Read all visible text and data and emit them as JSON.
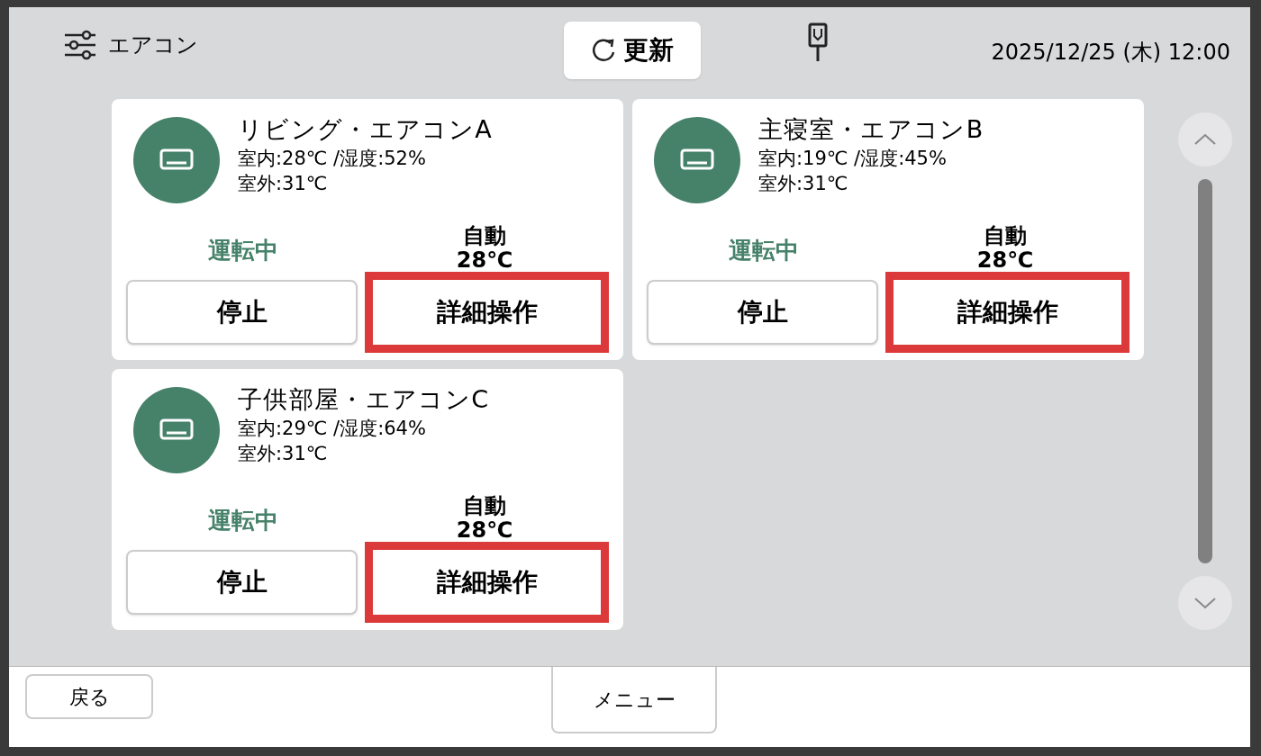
{
  "header": {
    "title": "エアコン",
    "refresh_button": "更新",
    "datetime": "2025/12/25 (木) 12:00"
  },
  "units": [
    {
      "name": "リビング・エアコンA",
      "indoor": "室内:28℃ /湿度:52%",
      "outdoor": "室外:31℃",
      "status": "運転中",
      "running": true,
      "mode": "自動",
      "setpoint": "28℃",
      "stop_button": "停止",
      "detail_button": "詳細操作",
      "highlighted": true
    },
    {
      "name": "主寝室・エアコンB",
      "indoor": "室内:19℃ /湿度:45%",
      "outdoor": "室外:31℃",
      "status": "運転中",
      "running": true,
      "mode": "自動",
      "setpoint": "28℃",
      "stop_button": "停止",
      "detail_button": "詳細操作",
      "highlighted": true
    },
    {
      "name": "子供部屋・エアコンC",
      "indoor": "室内:29℃ /湿度:64%",
      "outdoor": "室外:31℃",
      "status": "運転中",
      "running": true,
      "mode": "自動",
      "setpoint": "28℃",
      "stop_button": "停止",
      "detail_button": "詳細操作",
      "highlighted": true
    }
  ],
  "footer": {
    "back_button": "戻る",
    "menu_button": "メニュー"
  }
}
